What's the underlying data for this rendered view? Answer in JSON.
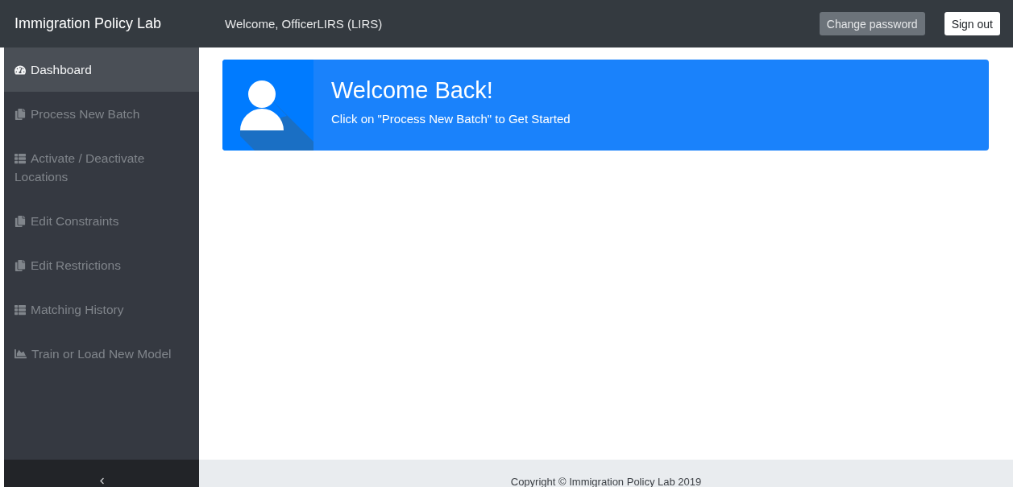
{
  "header": {
    "brand": "Immigration Policy Lab",
    "welcome": "Welcome, OfficerLIRS (LIRS)",
    "buttons": [
      {
        "label": "Change password",
        "kind": "secondary"
      },
      {
        "label": "Sign out",
        "kind": "light"
      }
    ]
  },
  "sidebar": {
    "items": [
      {
        "label": "Dashboard",
        "kind": "dashboard",
        "selected": true
      },
      {
        "label": "Process New Batch",
        "kind": "copy",
        "selected": false
      },
      {
        "label": "Activate / Deactivate Locations",
        "kind": "list",
        "selected": false
      },
      {
        "label": "Edit Constraints",
        "kind": "copy",
        "selected": false
      },
      {
        "label": "Edit Restrictions",
        "kind": "copy",
        "selected": false
      },
      {
        "label": "Matching History",
        "kind": "list",
        "selected": false
      },
      {
        "label": "Train or Load New Model",
        "kind": "chart",
        "selected": false
      }
    ]
  },
  "welcome_card": {
    "title": "Welcome Back!",
    "subtitle": "Click on \"Process New Batch\" to Get Started"
  },
  "footer": {
    "copyright": "Copyright © Immigration Policy Lab 2019"
  }
}
